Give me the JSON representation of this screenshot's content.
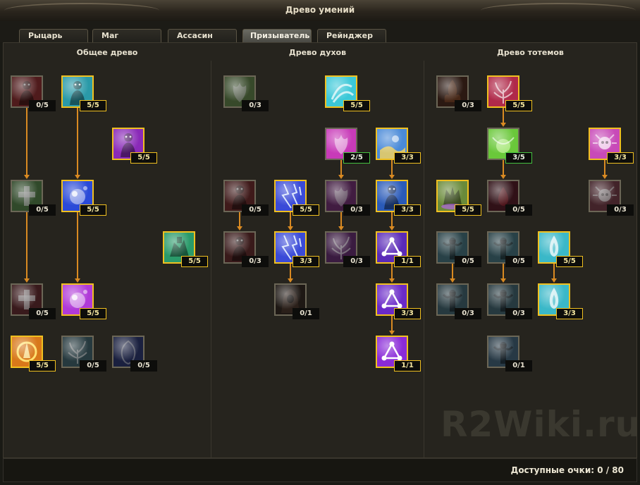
{
  "window": {
    "title": "Древо умений"
  },
  "tabs": [
    {
      "label": "Рыцарь",
      "active": false
    },
    {
      "label": "Маг",
      "active": false
    },
    {
      "label": "Ассасин",
      "active": false
    },
    {
      "label": "Призыватель",
      "active": true
    },
    {
      "label": "Рейнджер",
      "active": false
    }
  ],
  "trees": [
    {
      "title": "Общее древо"
    },
    {
      "title": "Древо духов"
    },
    {
      "title": "Древо тотемов"
    }
  ],
  "skills": [
    {
      "id": "g-demon-red",
      "icon": "red-demon-icon",
      "color": "#b0282a",
      "count": "0/5",
      "level": 0,
      "max": 5
    },
    {
      "id": "g-spirit-cyan",
      "icon": "cyan-spirit-icon",
      "color": "#2a9aa8",
      "count": "5/5",
      "level": 5,
      "max": 5
    },
    {
      "id": "g-purple-figure",
      "icon": "purple-figure-icon",
      "color": "#8a2ab8",
      "count": "5/5",
      "level": 5,
      "max": 5
    },
    {
      "id": "g-green-cross",
      "icon": "green-cross-icon",
      "color": "#4a8a3a",
      "count": "0/5",
      "level": 0,
      "max": 5
    },
    {
      "id": "g-blue-orb",
      "icon": "blue-orb-icon",
      "color": "#2a4ad8",
      "count": "5/5",
      "level": 5,
      "max": 5
    },
    {
      "id": "g-green-totem",
      "icon": "green-totem-icon",
      "color": "#2a9a6a",
      "count": "5/5",
      "level": 5,
      "max": 5
    },
    {
      "id": "g-red-cross",
      "icon": "red-cross-icon",
      "color": "#7a2a30",
      "count": "0/5",
      "level": 0,
      "max": 5
    },
    {
      "id": "g-purple-orb",
      "icon": "purple-orb-icon",
      "color": "#b03ad8",
      "count": "5/5",
      "level": 5,
      "max": 5
    },
    {
      "id": "g-fire-sigil",
      "icon": "fire-sigil-icon",
      "color": "#d8781a",
      "count": "5/5",
      "level": 5,
      "max": 5
    },
    {
      "id": "g-tree-teal",
      "icon": "tree-icon",
      "color": "#3a6a78",
      "count": "0/5",
      "level": 0,
      "max": 5
    },
    {
      "id": "g-blue-rune",
      "icon": "blue-rune-icon",
      "color": "#2a3a8a",
      "count": "0/5",
      "level": 0,
      "max": 5
    },
    {
      "id": "s-green-wisp",
      "icon": "green-wisp-icon",
      "color": "#5a8a3a",
      "count": "0/3",
      "level": 0,
      "max": 3
    },
    {
      "id": "s-cyan-swirl",
      "icon": "cyan-swirl-icon",
      "color": "#3ac8d8",
      "count": "5/5",
      "level": 5,
      "max": 5
    },
    {
      "id": "s-pink-flower",
      "icon": "pink-flower-icon",
      "color": "#c83ab8",
      "count": "2/5",
      "level": 2,
      "max": 5
    },
    {
      "id": "s-blue-yellow",
      "icon": "blue-yellow-icon",
      "color": "#4a8ad8",
      "count": "3/3",
      "level": 3,
      "max": 3
    },
    {
      "id": "s-red-demon-1",
      "icon": "red-demon-icon",
      "color": "#8a2a2a",
      "count": "0/5",
      "level": 0,
      "max": 5
    },
    {
      "id": "s-blue-lightning-1",
      "icon": "blue-lightning-icon",
      "color": "#3a4ad8",
      "count": "5/5",
      "level": 5,
      "max": 5
    },
    {
      "id": "s-purple-flower",
      "icon": "purple-flower-icon",
      "color": "#8a2a8a",
      "count": "0/3",
      "level": 0,
      "max": 3
    },
    {
      "id": "s-blue-figure",
      "icon": "blue-figure-icon",
      "color": "#2a5ab8",
      "count": "3/3",
      "level": 3,
      "max": 3
    },
    {
      "id": "s-red-demon-2",
      "icon": "red-demon-icon",
      "color": "#7a2a2a",
      "count": "0/3",
      "level": 0,
      "max": 3
    },
    {
      "id": "s-blue-lightning-2",
      "icon": "blue-lightning-icon",
      "color": "#3a4ad8",
      "count": "3/3",
      "level": 3,
      "max": 3
    },
    {
      "id": "s-purple-vine",
      "icon": "purple-vine-icon",
      "color": "#7a2a8a",
      "count": "0/3",
      "level": 0,
      "max": 3
    },
    {
      "id": "s-triangle-1",
      "icon": "triangle-rune-icon",
      "color": "#5a2ab8",
      "count": "1/1",
      "level": 1,
      "max": 1
    },
    {
      "id": "s-hooded",
      "icon": "hooded-figure-icon",
      "color": "#3a2a22",
      "count": "0/1",
      "level": 0,
      "max": 1
    },
    {
      "id": "s-triangle-2",
      "icon": "triangle-rune-icon",
      "color": "#6a2ac8",
      "count": "3/3",
      "level": 3,
      "max": 3
    },
    {
      "id": "s-triangle-3",
      "icon": "triangle-rune-icon",
      "color": "#8a2ad8",
      "count": "1/1",
      "level": 1,
      "max": 1
    },
    {
      "id": "t-dark-flame",
      "icon": "dark-flame-icon",
      "color": "#5a2a1a",
      "count": "0/3",
      "level": 0,
      "max": 3
    },
    {
      "id": "t-red-vine",
      "icon": "red-vine-icon",
      "color": "#b02a4a",
      "count": "5/5",
      "level": 5,
      "max": 5
    },
    {
      "id": "t-green-glow",
      "icon": "green-glow-icon",
      "color": "#6ac83a",
      "count": "3/5",
      "level": 3,
      "max": 5
    },
    {
      "id": "t-pink-skull",
      "icon": "pink-skull-icon",
      "color": "#c84ab8",
      "count": "3/3",
      "level": 3,
      "max": 3
    },
    {
      "id": "t-green-beast",
      "icon": "green-beast-icon",
      "color": "#6a8a3a",
      "count": "5/5",
      "level": 5,
      "max": 5
    },
    {
      "id": "t-blood-drop",
      "icon": "blood-drop-icon",
      "color": "#6a1a2a",
      "count": "0/5",
      "level": 0,
      "max": 5
    },
    {
      "id": "t-pink-skull-dim",
      "icon": "pink-skull-icon",
      "color": "#8a3a4a",
      "count": "0/3",
      "level": 0,
      "max": 3
    },
    {
      "id": "t-totem-1",
      "icon": "totem-icon",
      "color": "#3a7a8a",
      "count": "0/5",
      "level": 0,
      "max": 5
    },
    {
      "id": "t-totem-2",
      "icon": "totem-icon",
      "color": "#3a7a8a",
      "count": "0/5",
      "level": 0,
      "max": 5
    },
    {
      "id": "t-white-flame-1",
      "icon": "white-flame-icon",
      "color": "#3ab8c8",
      "count": "5/5",
      "level": 5,
      "max": 5
    },
    {
      "id": "t-totem-3",
      "icon": "totem-icon",
      "color": "#3a6a7a",
      "count": "0/3",
      "level": 0,
      "max": 3
    },
    {
      "id": "t-totem-4",
      "icon": "totem-icon",
      "color": "#3a6a7a",
      "count": "0/3",
      "level": 0,
      "max": 3
    },
    {
      "id": "t-white-flame-2",
      "icon": "white-flame-icon",
      "color": "#3ab8c8",
      "count": "3/3",
      "level": 3,
      "max": 3
    },
    {
      "id": "t-totem-5",
      "icon": "totem-icon",
      "color": "#3a6a8a",
      "count": "0/1",
      "level": 0,
      "max": 1
    }
  ],
  "watermark": "R2Wiki.ru",
  "footer": {
    "points": "Доступные очки: 0 / 80"
  }
}
